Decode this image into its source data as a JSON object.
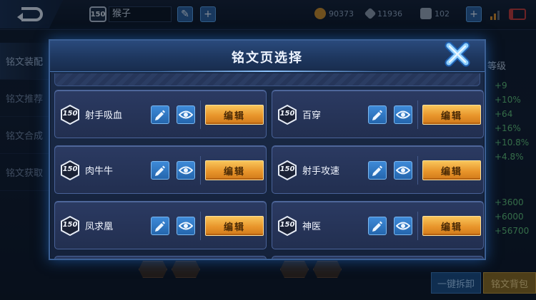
{
  "background": {
    "page_name": "猴子",
    "level_badge": "150",
    "currencies": [
      {
        "icon": "gold-coin-icon",
        "value": "90373",
        "color": "#c98a2a"
      },
      {
        "icon": "diamond-icon",
        "value": "11936",
        "color": "#8a97aa"
      },
      {
        "icon": "scroll-icon",
        "value": "102",
        "color": "#9aa6b8"
      }
    ],
    "side_tabs": [
      "铭文装配",
      "铭文推荐",
      "铭文合成",
      "铭文获取"
    ],
    "stats_title": "等级",
    "stats_top": [
      "+9",
      "+10%",
      "+64",
      "+16%",
      "+10.8%",
      "+4.8%"
    ],
    "stats_bottom": [
      "+3600",
      "+6000",
      "+56700"
    ],
    "bottom_buttons": {
      "unload": "一键拆卸",
      "bag": "铭文背包"
    }
  },
  "modal": {
    "title": "铭文页选择",
    "close_icon": "close-x-icon",
    "cards": [
      {
        "level": "150",
        "name": "射手吸血",
        "edit_label": "编辑"
      },
      {
        "level": "150",
        "name": "百穿",
        "edit_label": "编辑"
      },
      {
        "level": "150",
        "name": "肉牛牛",
        "edit_label": "编辑"
      },
      {
        "level": "150",
        "name": "射手攻速",
        "edit_label": "编辑"
      },
      {
        "level": "150",
        "name": "凤求凰",
        "edit_label": "编辑"
      },
      {
        "level": "150",
        "name": "神医",
        "edit_label": "编辑"
      }
    ]
  },
  "colors": {
    "accent_blue": "#3e8ad8",
    "edit_orange": "#e8952b",
    "modal_border": "#3b5f93"
  }
}
